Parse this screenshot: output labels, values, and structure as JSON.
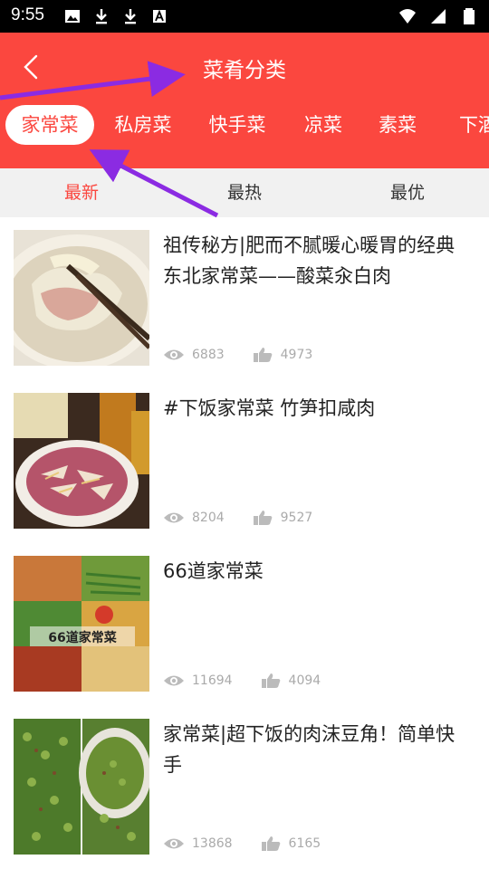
{
  "status_bar": {
    "time": "9:55",
    "left_icons": [
      "image-icon",
      "download-icon",
      "download-icon",
      "text-icon"
    ],
    "right_icons": [
      "wifi-icon",
      "signal-icon",
      "battery-icon"
    ]
  },
  "header": {
    "title": "菜肴分类",
    "bg_color": "#fb473f"
  },
  "categories": [
    {
      "label": "家常菜",
      "active": true
    },
    {
      "label": "私房菜",
      "active": false
    },
    {
      "label": "快手菜",
      "active": false
    },
    {
      "label": "凉菜",
      "active": false
    },
    {
      "label": "素菜",
      "active": false
    },
    {
      "label": "下酒",
      "active": false
    }
  ],
  "sort_tabs": [
    {
      "label": "最新",
      "active": true
    },
    {
      "label": "最热",
      "active": false
    },
    {
      "label": "最优",
      "active": false
    }
  ],
  "items": [
    {
      "title": "祖传秘方|肥而不腻暖心暖胃的经典东北家常菜——酸菜汆白肉",
      "views": "6883",
      "likes": "4973",
      "thumb": "soup-bowl"
    },
    {
      "title": "#下饭家常菜 竹笋扣咸肉",
      "views": "8204",
      "likes": "9527",
      "thumb": "meat-bowl"
    },
    {
      "title": "66道家常菜",
      "views": "11694",
      "likes": "4094",
      "thumb": "collage",
      "thumb_text": "66道家常菜"
    },
    {
      "title": "家常菜|超下饭的肉沫豆角！简单快手",
      "views": "13868",
      "likes": "6165",
      "thumb": "green-beans"
    }
  ],
  "colors": {
    "accent": "#fb473f",
    "sort_bg": "#f1f1f1",
    "annotation_arrow": "#8b2be2"
  }
}
